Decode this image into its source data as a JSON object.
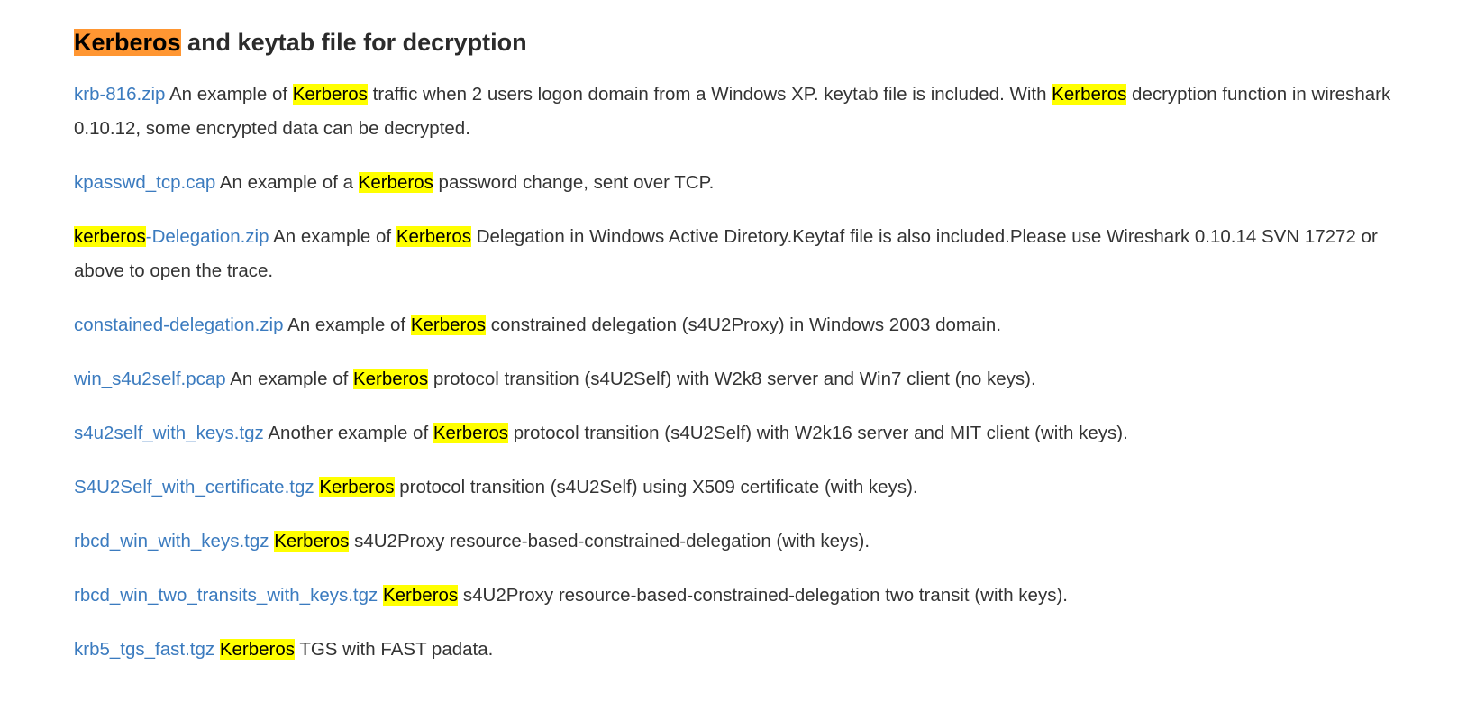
{
  "heading": {
    "highlight": "Kerberos",
    "rest": " and keytab file for decryption"
  },
  "search_term": "Kerberos",
  "colors": {
    "link": "#3b7bbf",
    "highlight": "#ffff00",
    "current_highlight": "#ff9632",
    "text": "#333333"
  },
  "entries": [
    {
      "link_pre": "krb-816.zip",
      "t1": " An example of ",
      "k1": "Kerberos",
      "t2": " traffic when 2 users logon domain from a Windows XP. keytab file is included. With ",
      "k2": "Kerberos",
      "t3": " decryption function in wireshark 0.10.12, some encrypted data can be decrypted."
    },
    {
      "link_pre": "kpasswd_tcp.cap",
      "t1": " An example of a ",
      "k1": "Kerberos",
      "t2": " password change, sent over TCP."
    },
    {
      "link_hl": "kerberos",
      "link_post": "-Delegation.zip",
      "t1": " An example of ",
      "k1": "Kerberos",
      "t2": " Delegation in Windows Active Diretory.Keytaf file is also included.Please use Wireshark 0.10.14 SVN 17272 or above to open the trace."
    },
    {
      "link_pre": "constained-delegation.zip",
      "t1": " An example of ",
      "k1": "Kerberos",
      "t2": " constrained delegation (s4U2Proxy) in Windows 2003 domain."
    },
    {
      "link_pre": "win_s4u2self.pcap",
      "t1": " An example of ",
      "k1": "Kerberos",
      "t2": " protocol transition (s4U2Self) with W2k8 server and Win7 client (no keys)."
    },
    {
      "link_pre": "s4u2self_with_keys.tgz",
      "t1": " Another example of ",
      "k1": "Kerberos",
      "t2": " protocol transition (s4U2Self) with W2k16 server and MIT client (with keys)."
    },
    {
      "link_pre": "S4U2Self_with_certificate.tgz",
      "t1": " ",
      "k1": "Kerberos",
      "t2": " protocol transition (s4U2Self) using X509 certificate (with keys)."
    },
    {
      "link_pre": "rbcd_win_with_keys.tgz",
      "t1": " ",
      "k1": "Kerberos",
      "t2": " s4U2Proxy resource-based-constrained-delegation (with keys)."
    },
    {
      "link_pre": "rbcd_win_two_transits_with_keys.tgz",
      "t1": " ",
      "k1": "Kerberos",
      "t2": " s4U2Proxy resource-based-constrained-delegation two transit (with keys)."
    },
    {
      "link_pre": "krb5_tgs_fast.tgz",
      "t1": " ",
      "k1": "Kerberos",
      "t2": " TGS with FAST padata."
    }
  ]
}
